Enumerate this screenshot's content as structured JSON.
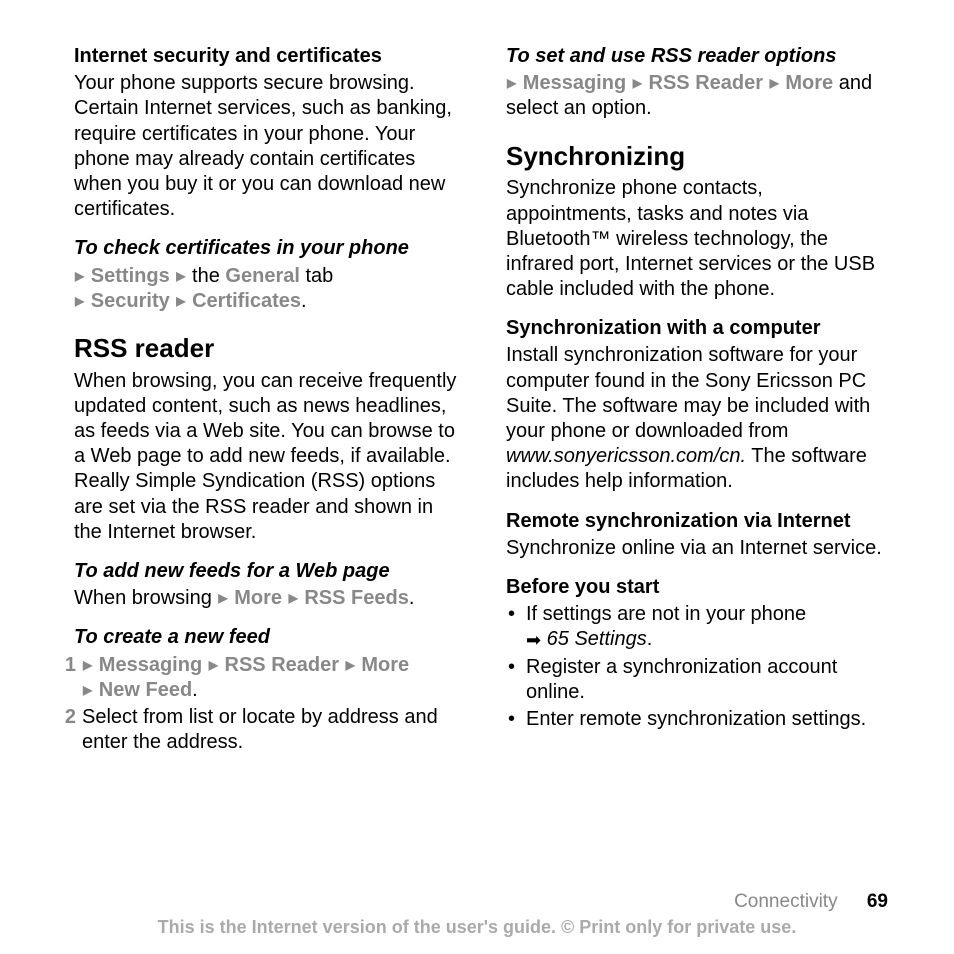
{
  "left": {
    "sec1": {
      "heading": "Internet security and certificates",
      "body": "Your phone supports secure browsing. Certain Internet services, such as banking, require certificates in your phone. Your phone may already contain certificates when you buy it or you can download new certificates."
    },
    "instr1": {
      "heading": "To check certificates in your phone",
      "step1_nav_settings": "Settings",
      "step1_text_the": " the ",
      "step1_nav_general": "General",
      "step1_text_tab": " tab",
      "step2_nav_security": "Security",
      "step2_nav_certs": "Certificates",
      "step2_period": "."
    },
    "sec2": {
      "heading": "RSS reader",
      "body": "When browsing, you can receive frequently updated content, such as news headlines, as feeds via a Web site. You can browse to a Web page to add new feeds, if available. Really Simple Syndication (RSS) options are set via the RSS reader and shown in the Internet browser."
    },
    "instr2": {
      "heading": "To add new feeds for a Web page",
      "prefix": "When browsing ",
      "nav_more": "More",
      "nav_rss": "RSS Feeds",
      "period": "."
    },
    "instr3": {
      "heading": "To create a new feed",
      "li1_nav_msg": "Messaging",
      "li1_nav_rss": "RSS Reader",
      "li1_nav_more": "More",
      "li1_nav_new": "New Feed",
      "li1_period": ".",
      "li2": "Select from list or locate by address and enter the address."
    }
  },
  "right": {
    "instr1": {
      "heading": "To set and use RSS reader options",
      "nav_msg": "Messaging",
      "nav_rss": "RSS Reader",
      "nav_more": "More",
      "suffix": " and select an option."
    },
    "sec1": {
      "heading": "Synchronizing",
      "body": "Synchronize phone contacts, appointments, tasks and notes via Bluetooth™ wireless technology, the infrared port, Internet services or the USB cable included with the phone."
    },
    "sec2": {
      "heading": "Synchronization with a computer",
      "body_pre": "Install synchronization software for your computer found in the Sony Ericsson PC Suite. The software may be included with your phone or downloaded from ",
      "body_url": "www.sonyericsson.com/cn.",
      "body_post": " The software includes help information."
    },
    "sec3": {
      "heading": "Remote synchronization via Internet",
      "body": "Synchronize online via an Internet service."
    },
    "sec4": {
      "heading": "Before you start",
      "b1_pre": "If settings are not in your phone ",
      "b1_link": "65 Settings",
      "b1_period": ".",
      "b2": "Register a synchronization account online.",
      "b3": "Enter remote synchronization settings."
    }
  },
  "footer": {
    "section": "Connectivity",
    "page": "69",
    "disclaimer": "This is the Internet version of the user's guide. © Print only for private use."
  }
}
